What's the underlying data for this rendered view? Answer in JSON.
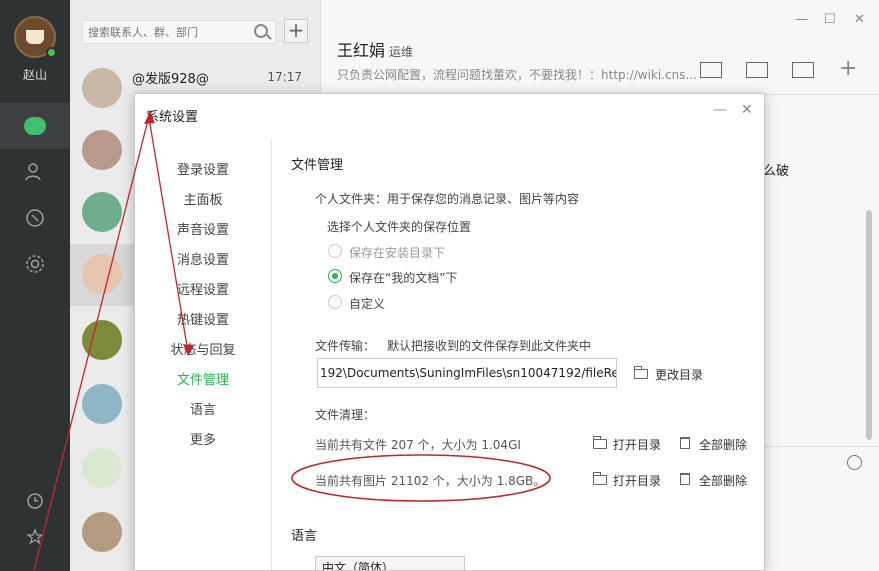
{
  "user": {
    "name": "赵山"
  },
  "search": {
    "placeholder": "搜索联系人、群、部门"
  },
  "conversations": [
    {
      "name": "@发版928@",
      "time": "17:17"
    }
  ],
  "chat": {
    "title": "王红娟",
    "role": "运维",
    "subtitle": "只负责公网配置，流程问题找董欢，不要找我！：http://wiki.cns...",
    "text_fragment": "么破"
  },
  "dialog": {
    "title": "系统设置",
    "nav": [
      {
        "label": "登录设置"
      },
      {
        "label": "主面板"
      },
      {
        "label": "声音设置"
      },
      {
        "label": "消息设置"
      },
      {
        "label": "远程设置"
      },
      {
        "label": "热键设置"
      },
      {
        "label": "状态与回复"
      },
      {
        "label": "文件管理"
      },
      {
        "label": "语言"
      },
      {
        "label": "更多"
      }
    ],
    "active_nav": "文件管理",
    "file_mgmt": {
      "section_title": "文件管理",
      "personal_folder": "个人文件夹：用于保存您的消息记录、图片等内容",
      "choose_location": "选择个人文件夹的保存位置",
      "options": [
        {
          "label": "保存在安装目录下",
          "selected": false,
          "disabled": true
        },
        {
          "label": "保存在“我的文档”下",
          "selected": true,
          "disabled": false
        },
        {
          "label": "自定义",
          "selected": false,
          "disabled": false
        }
      ],
      "transfer_label": "文件传输：",
      "transfer_desc": "默认把接收到的文件保存到此文件夹中",
      "transfer_path": "192\\Documents\\SuningImFiles\\sn10047192/fileRec",
      "change_dir": "更改目录",
      "cleanup_label": "文件清理：",
      "files_summary": "当前共有文件 207 个，大小为 1.04GI",
      "images_summary": "当前共有图片 21102 个，大小为 1.8GB。",
      "open_dir": "打开目录",
      "delete_all": "全部删除"
    },
    "language": {
      "section_title": "语言",
      "selected": "中文（简体）"
    }
  },
  "colors": {
    "accent_green": "#2bb24c",
    "rail_bg": "#2f3233",
    "annotation_red": "#c0272d"
  }
}
